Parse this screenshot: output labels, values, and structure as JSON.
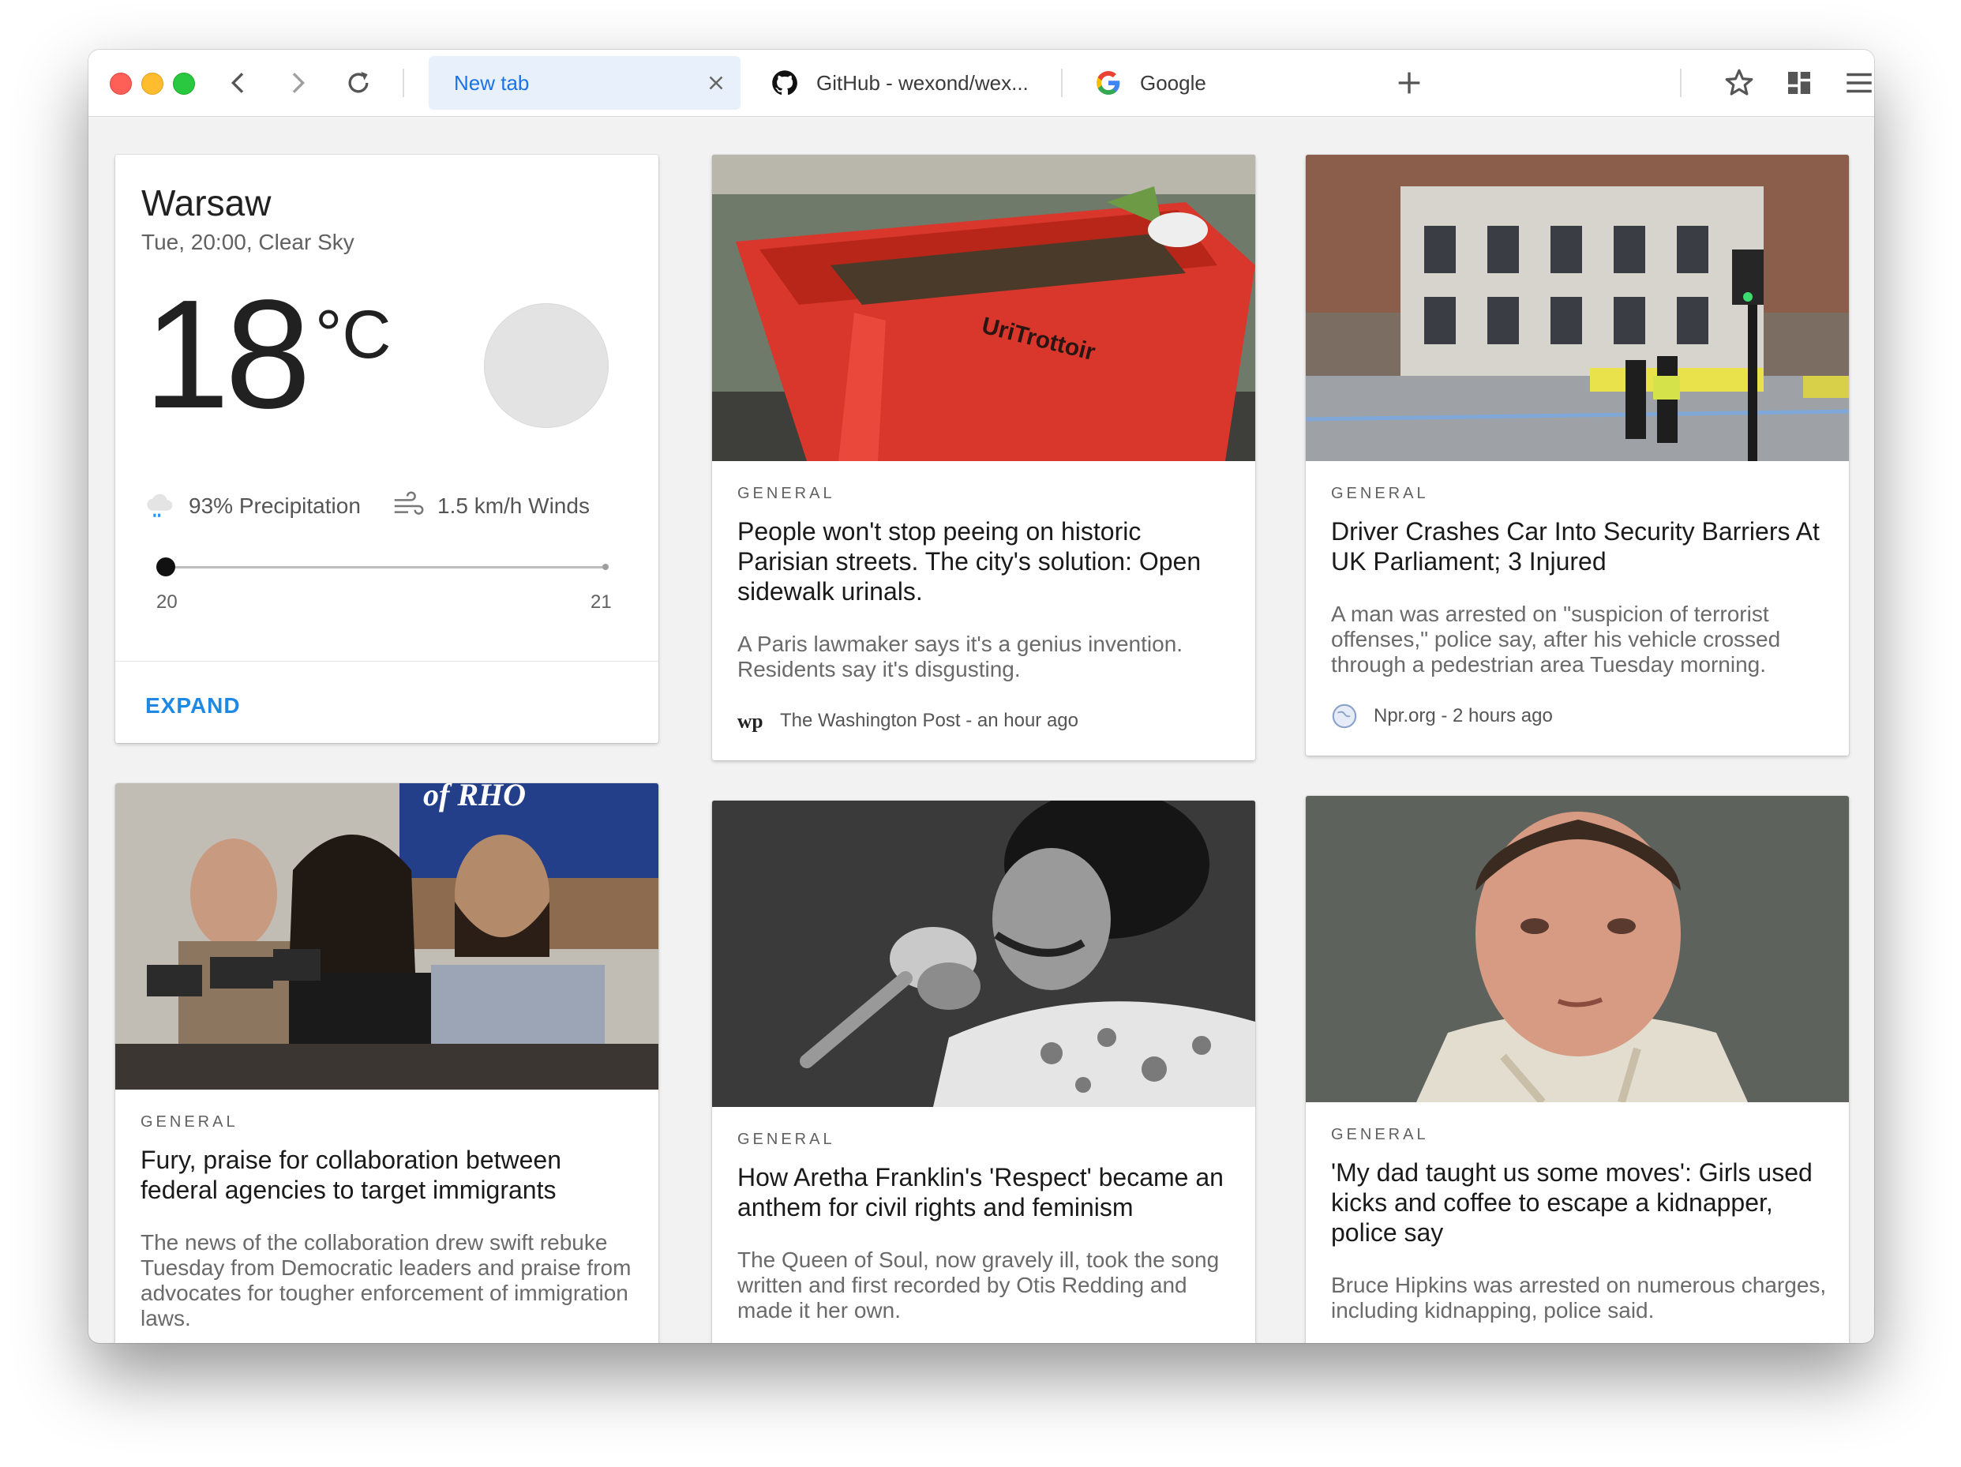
{
  "tabs": [
    {
      "label": "New tab",
      "active": true
    },
    {
      "label": "GitHub - wexond/wex...",
      "icon": "github-icon"
    },
    {
      "label": "Google",
      "icon": "google-icon"
    }
  ],
  "weather": {
    "city": "Warsaw",
    "subtitle": "Tue, 20:00, Clear Sky",
    "temp": "18",
    "unit": "°C",
    "precipitation": "93% Precipitation",
    "winds": "1.5 km/h Winds",
    "slider_start": "20",
    "slider_end": "21",
    "slider_fraction": 0,
    "expand": "EXPAND"
  },
  "news": [
    {
      "category": "GENERAL",
      "title": "People won't stop peeing on historic Parisian streets. The city's solution: Open sidewalk urinals.",
      "description": "A Paris lawmaker says it's a genius invention. Residents say it's disgusting.",
      "source": "The Washington Post - an hour ago",
      "source_icon": "wp-icon",
      "image_text": "UriTrottoir"
    },
    {
      "category": "GENERAL",
      "title": "Driver Crashes Car Into Security Barriers At UK Parliament; 3 Injured",
      "description": "A man was arrested on \"suspicion of terrorist offenses,\" police say, after his vehicle crossed through a pedestrian area Tuesday morning.",
      "source": "Npr.org - 2 hours ago",
      "source_icon": "globe-icon"
    },
    {
      "category": "GENERAL",
      "title": "Fury, praise for collaboration between federal agencies to target immigrants",
      "description": "The news of the collaboration drew swift rebuke Tuesday from Democratic leaders and praise from advocates for tougher enforcement of immigration laws.",
      "image_text": "of RHO"
    },
    {
      "category": "GENERAL",
      "title": "How Aretha Franklin's 'Respect' became an anthem for civil rights and feminism",
      "description": "The Queen of Soul, now gravely ill, took the song written and first recorded by Otis Redding and made it her own."
    },
    {
      "category": "GENERAL",
      "title": "'My dad taught us some moves': Girls used kicks and coffee to escape a kidnapper, police say",
      "description": "Bruce Hipkins was arrested on numerous charges, including kidnapping, police said."
    }
  ]
}
